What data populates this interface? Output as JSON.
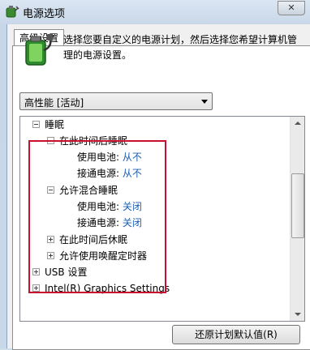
{
  "window": {
    "title": "电源选项",
    "close_label": "✕"
  },
  "tab": {
    "label": "高级设置"
  },
  "description": "选择您要自定义的电源计划，然后选择您希望计算机管理的电源设置。",
  "plan_select": {
    "value": "高性能 [活动]"
  },
  "tree": {
    "sleep": {
      "label": "睡眠",
      "sleep_after": {
        "label": "在此时间后睡眠",
        "battery_label": "使用电池:",
        "battery_value": "从不",
        "plugged_label": "接通电源:",
        "plugged_value": "从不"
      },
      "hybrid_sleep": {
        "label": "允许混合睡眠",
        "battery_label": "使用电池:",
        "battery_value": "关闭",
        "plugged_label": "接通电源:",
        "plugged_value": "关闭"
      },
      "hibernate_after": {
        "label": "在此时间后休眠"
      },
      "wake_timers": {
        "label": "允许使用唤醒定时器"
      }
    },
    "usb": {
      "label": "USB 设置"
    },
    "intel_graphics": {
      "label": "Intel(R) Graphics Settings"
    }
  },
  "buttons": {
    "restore_defaults": "还原计划默认值(R)"
  },
  "colors": {
    "highlight_border": "#c8102e",
    "value_link": "#1a5fb4"
  }
}
